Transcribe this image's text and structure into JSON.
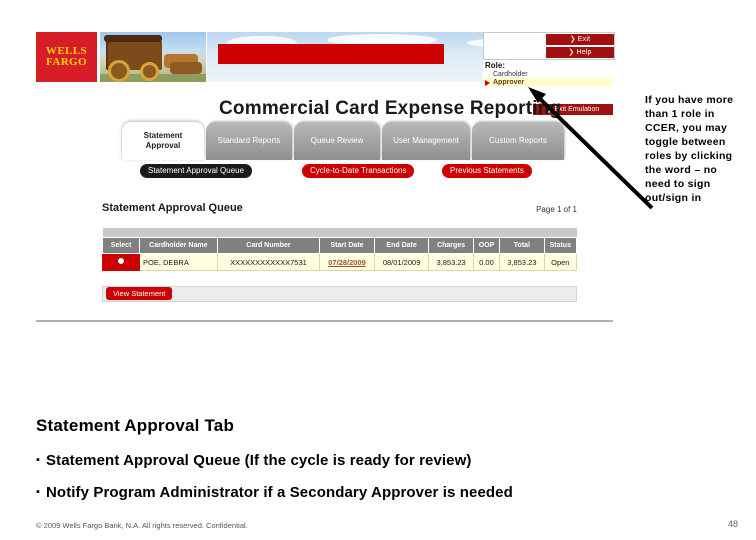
{
  "app": {
    "brand": {
      "line1": "WELLS",
      "line2": "FARGO"
    },
    "title": "Commercial Card Expense Reporting",
    "utility_buttons": [
      {
        "label": "Exit",
        "icon": "chevron-right-icon"
      },
      {
        "label": "Help",
        "icon": "chevron-right-icon"
      }
    ],
    "role_panel": {
      "heading": "Role:",
      "items": [
        {
          "label": "Cardholder",
          "active": false
        },
        {
          "label": "Approver",
          "active": true
        }
      ],
      "exit_emulation_label": "Exit Emulation"
    },
    "tabs": [
      {
        "label": "Statement Approval",
        "active": true
      },
      {
        "label": "Standard Reports",
        "active": false
      },
      {
        "label": "Queue Review",
        "active": false
      },
      {
        "label": "User Management",
        "active": false
      },
      {
        "label": "Custom Reports",
        "active": false
      }
    ],
    "subnav": [
      {
        "label": "Statement Approval Queue",
        "active": true
      },
      {
        "label": "Cycle-to-Date Transactions",
        "active": false
      },
      {
        "label": "Previous Statements",
        "active": false
      }
    ],
    "queue": {
      "title": "Statement Approval Queue",
      "page_indicator": "Page 1 of 1",
      "columns": [
        "Select",
        "Cardholder Name",
        "Card Number",
        "Start Date",
        "End Date",
        "Charges",
        "OOP",
        "Total",
        "Status"
      ],
      "rows": [
        {
          "selected": true,
          "cardholder_name": "POE, DEBRA",
          "card_number": "XXXXXXXXXXXX7531",
          "start_date": "07/28/2009",
          "end_date": "08/01/2009",
          "charges": "3,853.23",
          "oop": "0.00",
          "total": "3,853.23",
          "status": "Open"
        }
      ],
      "view_statement_label": "View Statement"
    }
  },
  "annotation": {
    "text": "If you have more than 1 role in CCER, you may toggle between roles by clicking the word – no need to sign out/sign in"
  },
  "slide": {
    "heading": "Statement Approval Tab",
    "bullets": [
      "Statement Approval Queue (If the cycle is ready for review)",
      "Notify Program Administrator if a Secondary Approver is needed"
    ]
  },
  "footer": {
    "copyright": "© 2009 Wells Fargo Bank, N.A. All rights reserved.  Confidential.",
    "page_number": "48"
  },
  "colors": {
    "brand_red": "#d71e28",
    "banner_red": "#cc0000",
    "button_red": "#a01010",
    "tab_gray": "#8f8f8f",
    "row_yellow": "#ffffe0",
    "highlight_yellow": "#ffffcc"
  }
}
